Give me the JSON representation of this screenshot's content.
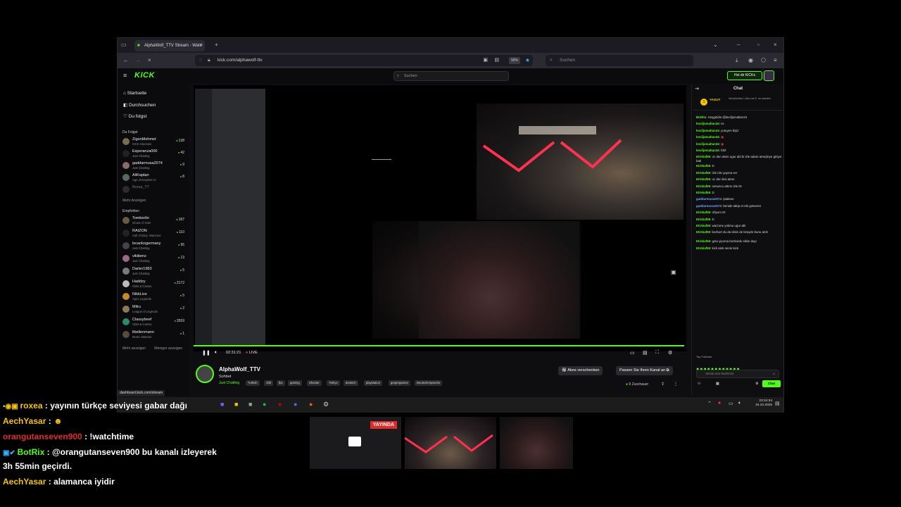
{
  "browser": {
    "tab_title": "AlphaWolf_TTV Stream - Watc",
    "url": "kick.com/alphawolf-ttv",
    "zoom": "90%",
    "search_placeholder": "Suchen"
  },
  "kick": {
    "logo": "KICK",
    "search_placeholder": "Suchen",
    "get_kicks": "Hol dir KICKs"
  },
  "sidebar": {
    "nav": [
      "Startseite",
      "Durchsuchen",
      "Du folgst"
    ],
    "following_title": "Du Folgst",
    "following": [
      {
        "name": "ZigonMehmet",
        "cat": "KICK Stunnies",
        "viewers": "138"
      },
      {
        "name": "Esperanza000",
        "cat": "Just Chatting",
        "viewers": "42"
      },
      {
        "name": "gaddarmusa2074",
        "cat": "Just Chatting",
        "viewers": "9"
      },
      {
        "name": "AliKaptan",
        "cat": "Age of Empires IV",
        "viewers": "8"
      },
      {
        "name": "Borsa_TT",
        "cat": "",
        "viewers": ""
      }
    ],
    "show_more": "Mehr Anzeigen",
    "recommended_title": "Empfohlen",
    "recommended": [
      {
        "name": "Tomberlin",
        "cat": "Ghost of Yotei",
        "viewers": "187"
      },
      {
        "name": "RAIZON",
        "cat": "Call of Duty: Warzone",
        "viewers": "110"
      },
      {
        "name": "lecankogermany",
        "cat": "Just Chatting",
        "viewers": "95"
      },
      {
        "name": "vikibenz",
        "cat": "Just Chatting",
        "viewers": "13"
      },
      {
        "name": "Darter1983",
        "cat": "Just Chatting",
        "viewers": "5"
      },
      {
        "name": "Haddzy",
        "cat": "Slots & Casino",
        "viewers": "2172"
      },
      {
        "name": "NikkLive",
        "cat": "Apex Legends",
        "viewers": "5"
      },
      {
        "name": "Milru",
        "cat": "League of Legends",
        "viewers": "2"
      },
      {
        "name": "Classybeef",
        "cat": "Slots & Casino",
        "viewers": "3559"
      },
      {
        "name": "libellenmann",
        "cat": "Music Stations",
        "viewers": "1"
      }
    ],
    "more": "Mehr anzeigen",
    "less": "Weniger anzeigen"
  },
  "player": {
    "time": "02:31:21",
    "live": "LIVE"
  },
  "stream": {
    "channel": "AlphaWolf_TTV",
    "title": "Sohbet",
    "category": "Just Chatting",
    "tags": [
      "Turkish",
      "chill",
      "fps",
      "gaming",
      "Shooter",
      "Türkçe",
      "deutsch",
      "playstation",
      "gergergamee",
      "DeutscheSprache"
    ],
    "gift_subs": "Abos verschenken",
    "customize": "Passen Sie Ihren Kanal an",
    "viewers": "9 Zuschauer",
    "status": "dashboard.kick.com/stream"
  },
  "chat": {
    "title": "Chat",
    "pinned_user": "YAGUT",
    "pinned_text": "Verschenke 1 Abo um 2. zu werden",
    "messages": [
      {
        "user": "BotRix",
        "text": "Hoşgeldin @keciljomaltan34",
        "style": "g"
      },
      {
        "user": "keciljomaltan34",
        "text": "ss",
        "style": "g"
      },
      {
        "user": "keciljomaltan34",
        "text": "yutuyen bişiz",
        "style": "g"
      },
      {
        "user": "keciljomaltan34",
        "text": "",
        "style": "g"
      },
      {
        "user": "keciljomaltan34",
        "text": "",
        "style": "g"
      },
      {
        "user": "keciljomaltan34",
        "text": "fdsf",
        "style": "g"
      },
      {
        "user": "EtiAkaf59",
        "text": "oc den attım ugur abi bi izle adam ameçleye giriyor bak",
        "style": "g"
      },
      {
        "user": "EtiAkaf59",
        "text": "D",
        "style": "g"
      },
      {
        "user": "EtiAkaf59",
        "text": "izle izle yayına ver",
        "style": "g"
      },
      {
        "user": "EtiAkaf59",
        "text": "oc den bisi attım",
        "style": "g"
      },
      {
        "user": "EtiAkaf59",
        "text": "sonuncu attımı izle ID",
        "style": "g"
      },
      {
        "user": "EtiAkaf59",
        "text": "D",
        "style": "g"
      },
      {
        "user": "gaddarmusa2074",
        "text": "iptaleee",
        "style": "b"
      },
      {
        "user": "gaddarmusa2074",
        "text": "benide takip et ebi gotveren",
        "style": "b"
      },
      {
        "user": "EtiAkaf59",
        "text": "izliyom ID",
        "style": "g"
      },
      {
        "user": "EtiAkaf59",
        "text": "D",
        "style": "g"
      },
      {
        "user": "EtiAkaf59",
        "text": "warzone yokmu ugur abi",
        "style": "g"
      },
      {
        "user": "EtiAkaf59",
        "text": "bozkurt du da silsin de kirayim bunu amk",
        "style": "g"
      },
      {
        "user": "EtiAkaf59",
        "text": "gotu yiyorsa bozkurdu silsin dayi",
        "style": "g"
      },
      {
        "user": "EtiAkaf59",
        "text": "kick amk senin kick",
        "style": "g"
      }
    ],
    "input_placeholder": "Sende eine Nachricht",
    "send": "Chat",
    "followers_label": "Top Follower"
  },
  "taskbar": {
    "time": "23:24:34",
    "date": "15.10.2025"
  },
  "overlay": {
    "messages": [
      {
        "user": "roxea",
        "text": "yayının türkçe seviyesi gabar dağı",
        "color": "user-white"
      },
      {
        "user": "AechYasar",
        "text": "",
        "color": "user-yellow"
      },
      {
        "user": "orangutanseven900",
        "text": "!watchtime",
        "color": "user-red"
      },
      {
        "user": "BotRix",
        "text": "@orangutanseven900 bu kanalı izleyerek",
        "color": "user-green"
      },
      {
        "user": "",
        "text": "3h 55min geçirdi.",
        "color": "none"
      },
      {
        "user": "AechYasar",
        "text": "alamanca iyidir",
        "color": "user-yellow"
      }
    ],
    "live_badge": "YAYINDA"
  },
  "colors": {
    "kick_green": "#53fc18",
    "background": "#0e0e10",
    "overlay_yellow": "#f5c400",
    "overlay_red": "#e02b2b"
  }
}
